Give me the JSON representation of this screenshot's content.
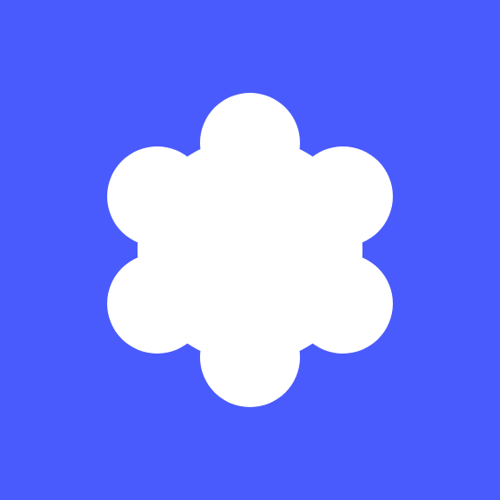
{
  "logo": {
    "icon": "flower-blob-icon",
    "background_color": "#4A5BFD",
    "shape_color": "#FFFFFF",
    "shape": "six-lobed rounded blob (hexagonal flower)"
  }
}
